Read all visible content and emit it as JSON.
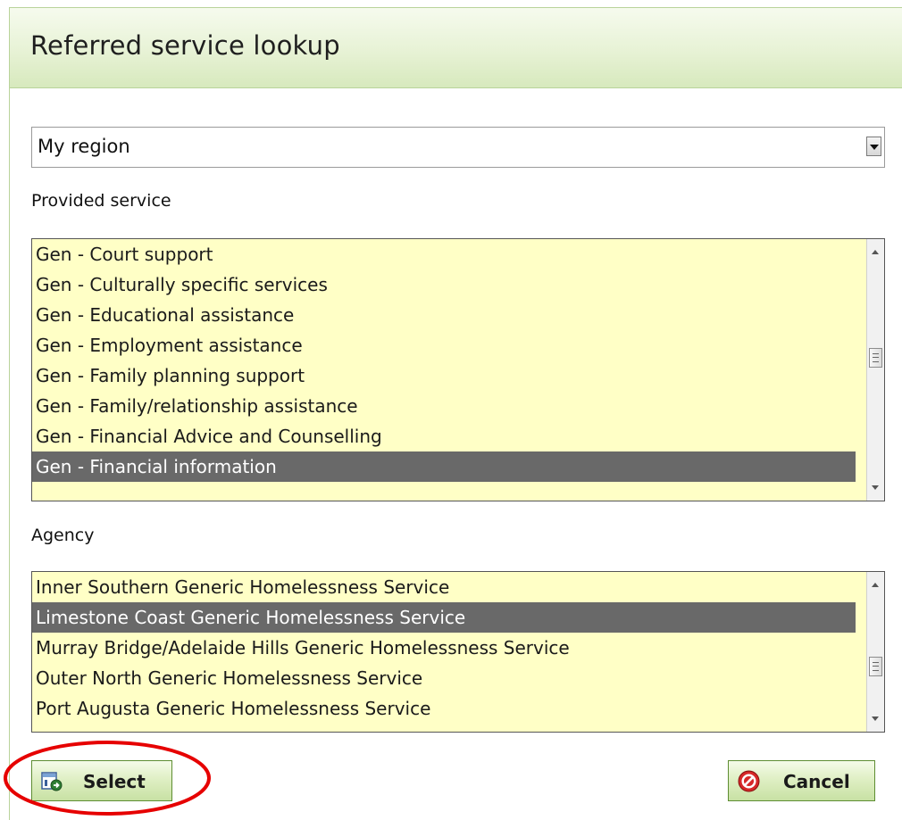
{
  "dialog": {
    "title": "Referred service lookup"
  },
  "region_select": {
    "selected": "My region"
  },
  "provided_service": {
    "label": "Provided service",
    "items": [
      "Gen - Court support",
      "Gen - Culturally specific services",
      "Gen - Educational assistance",
      "Gen - Employment assistance",
      "Gen - Family planning support",
      "Gen - Family/relationship assistance",
      "Gen - Financial Advice and Counselling",
      "Gen - Financial information"
    ],
    "selected_index": 7
  },
  "agency": {
    "label": "Agency",
    "items": [
      "Inner Southern Generic Homelessness Service",
      "Limestone Coast Generic Homelessness Service",
      "Murray Bridge/Adelaide Hills Generic Homelessness Service",
      "Outer North Generic Homelessness Service",
      "Port Augusta Generic Homelessness Service"
    ],
    "selected_index": 1
  },
  "buttons": {
    "select_label": "Select",
    "cancel_label": "Cancel"
  },
  "colors": {
    "header_green": "#e7f2d5",
    "list_background": "#ffffc6",
    "selected_row": "#696969",
    "highlight_ring": "#e60000"
  }
}
